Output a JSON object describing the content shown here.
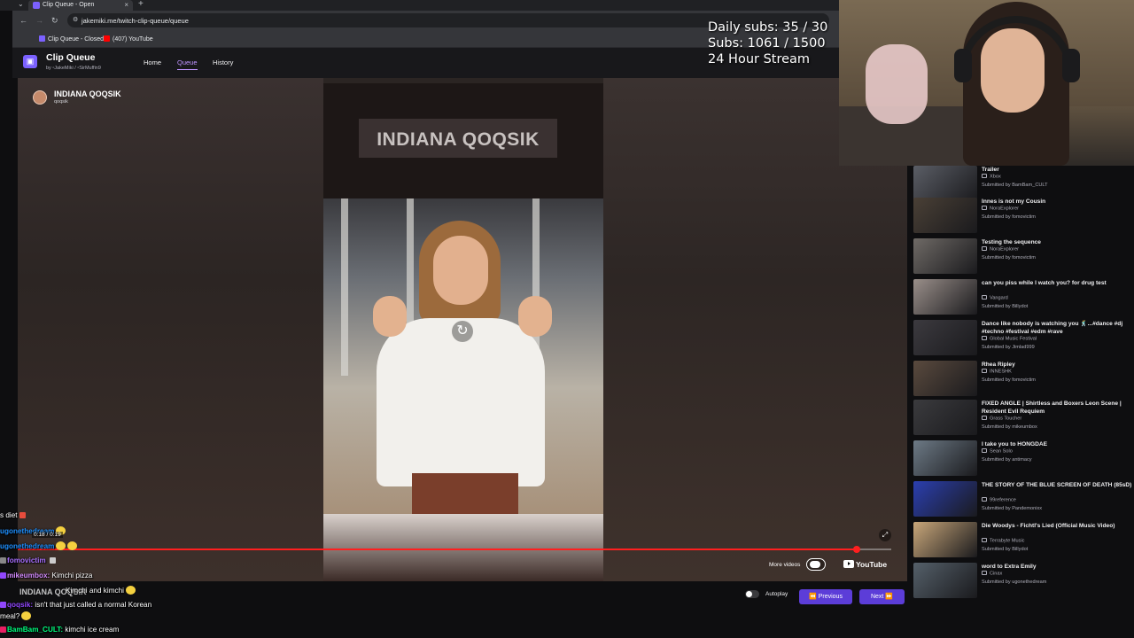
{
  "browser": {
    "tab_title": "Clip Queue - Open",
    "url": "jakemiki.me/twitch-clip-queue/queue",
    "bookmarks": [
      {
        "label": "Clip Queue - Closed",
        "color": "#7b61ff"
      },
      {
        "label": "(407) YouTube",
        "color": "#ff0000"
      }
    ]
  },
  "app": {
    "title": "Clip Queue",
    "by_prefix": "by",
    "author1": "JakeMiki",
    "author2": "SirMuffin9",
    "nav": [
      {
        "label": "Home"
      },
      {
        "label": "Queue"
      },
      {
        "label": "History"
      }
    ]
  },
  "current_clip": {
    "channel_name": "INDIANA QOQSIK",
    "handle": "qoqsik",
    "video_caption": "INDIANA QOQSIK",
    "progress": 0.96
  },
  "player_controls": {
    "more_videos": "More videos",
    "youtube": "YouTube",
    "autoplay": "Autoplay",
    "previous": "Previous",
    "next": "Next"
  },
  "stream_overlay": {
    "daily_subs": "Daily subs: 35 / 30",
    "subs": "Subs: 1061 / 1500",
    "event": "24 Hour Stream"
  },
  "queue": [
    {
      "title": "Trailer",
      "channel": "Xbox",
      "submitted": "Submitted by BamBam_CULT",
      "thumb": "#5b5e66"
    },
    {
      "title": "Innes is not my Cousin",
      "channel": "NoraExplorer",
      "submitted": "Submitted by fomovictim",
      "thumb": "#4a4036"
    },
    {
      "title": "Testing the sequence",
      "channel": "NoraExplorer",
      "submitted": "Submitted by fomovictim",
      "thumb": "#6f6a66"
    },
    {
      "title": "can you piss while I watch you? for drug test",
      "channel": "Vangard",
      "submitted": "Submitted by Billydot",
      "thumb": "#9a8f8a"
    },
    {
      "title": "Dance like nobody is watching you 🕺...#dance #dj #techno #festival #edm #rave",
      "channel": "Global Music Festival",
      "submitted": "Submitted by Jimlad999",
      "thumb": "#3c3a3f"
    },
    {
      "title": "Rhea Ripley",
      "channel": "INNESHK",
      "submitted": "Submitted by fomovictim",
      "thumb": "#5a4a3e"
    },
    {
      "title": "FIXED ANGLE | Shirtless and Boxers Leon Scene | Resident Evil Requiem",
      "channel": "Grass Toucher",
      "submitted": "Submitted by mikeumbox",
      "thumb": "#3b3b3e"
    },
    {
      "title": "I take you to HONGDAE",
      "channel": "Sean Solo",
      "submitted": "Submitted by antimacy",
      "thumb": "#6d7a86"
    },
    {
      "title": "THE STORY OF THE BLUE SCREEN OF DEATH (85sD)",
      "channel": "99reference",
      "submitted": "Submitted by Pandemonixx",
      "thumb": "#2b3fb0"
    },
    {
      "title": "Die Woodys - Fichtl's Lied (Official Music Video)",
      "channel": "Terrabyte Music",
      "submitted": "Submitted by Billydot",
      "thumb": "#c9a77a"
    },
    {
      "title": "word to Extra Emily",
      "channel": "Cinax",
      "submitted": "Submitted by ugonethedream",
      "thumb": "#55606a"
    }
  ],
  "chat": {
    "timestamp": "0:18 / 0:19",
    "ghost_title": "INDIANA QOQSIK",
    "lines": [
      {
        "user": "",
        "msg": "s diet",
        "color": "#ffffff"
      },
      {
        "user": "ugonethedream",
        "msg": "",
        "color": "#1e90ff"
      },
      {
        "user": "ugonethedream",
        "msg": "",
        "color": "#1e90ff"
      },
      {
        "user": "fomovictim",
        "msg": "",
        "color": "#a970ff"
      },
      {
        "user": "mikeumbox:",
        "msg": "Kimchi pizza",
        "color": "#d58cff"
      },
      {
        "user": "",
        "msg": "Kimchi and kimchi",
        "color": "#ffffff"
      },
      {
        "user": "qoqsik:",
        "msg": "isn't that just called a normal Korean",
        "color": "#9147ff"
      },
      {
        "user": "",
        "msg": "meal?",
        "color": "#ffffff"
      },
      {
        "user": "BamBam_CULT:",
        "msg": "kimchi ice cream",
        "color": "#00ff7f"
      }
    ]
  }
}
